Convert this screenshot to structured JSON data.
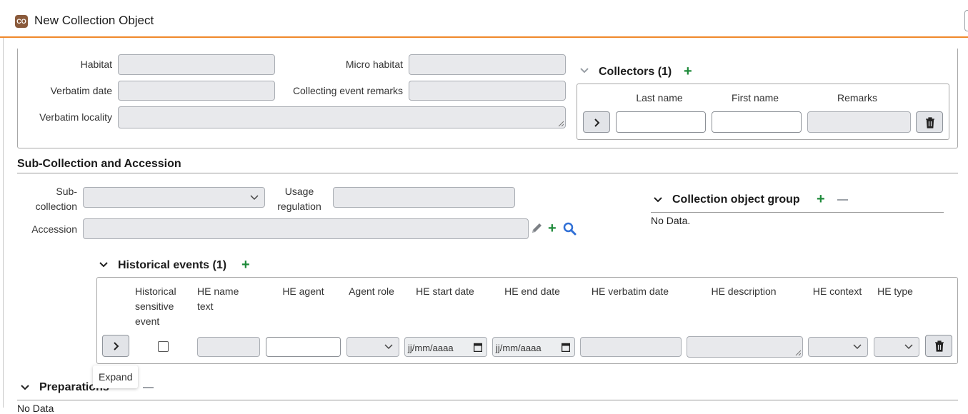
{
  "window": {
    "badge": "CO",
    "title": "New Collection Object"
  },
  "collecting_event": {
    "habitat_label": "Habitat",
    "micro_habitat_label": "Micro habitat",
    "verbatim_date_label": "Verbatim date",
    "remarks_label": "Collecting event remarks",
    "verbatim_locality_label": "Verbatim locality"
  },
  "collectors": {
    "title": "Collectors (1)",
    "columns": [
      "Last name",
      "First name",
      "Remarks"
    ]
  },
  "subcollection": {
    "section_title": "Sub-Collection and Accession",
    "subcollection_label_1": "Sub-",
    "subcollection_label_2": "collection",
    "usage_label_1": "Usage",
    "usage_label_2": "regulation",
    "accession_label": "Accession"
  },
  "co_group": {
    "title": "Collection object group",
    "empty": "No Data."
  },
  "historical_events": {
    "title": "Historical events (1)",
    "col_sensitive_1": "Historical",
    "col_sensitive_2": "sensitive",
    "col_sensitive_3": "event",
    "col_name_1": "HE name",
    "col_name_2": "text",
    "col_agent": "HE agent",
    "col_role": "Agent role",
    "col_start": "HE start date",
    "col_end": "HE end date",
    "col_verbatim": "HE verbatim date",
    "col_description": "HE description",
    "col_context": "HE context",
    "col_type": "HE type",
    "date_placeholder": "jj/mm/aaaa"
  },
  "tooltip": {
    "expand": "Expand"
  },
  "preparations": {
    "title": "Preparations",
    "empty": "No Data"
  },
  "colors": {
    "accent_orange": "#f0892b",
    "add_green": "#1e8a3a",
    "search_blue": "#2f6fd6"
  }
}
